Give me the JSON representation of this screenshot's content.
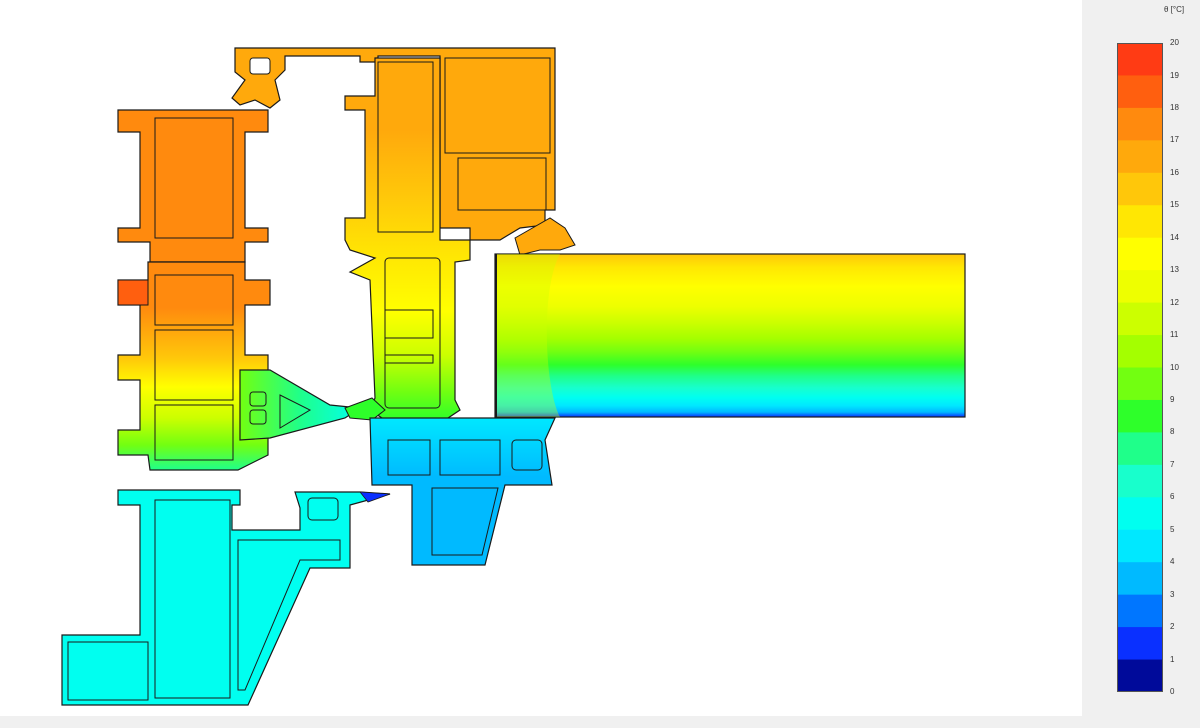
{
  "legend": {
    "unit_label": "θ [°C]",
    "ticks": [
      "20",
      "19",
      "18",
      "17",
      "16",
      "15",
      "14",
      "13",
      "12",
      "11",
      "10",
      "9",
      "8",
      "7",
      "6",
      "5",
      "4",
      "3",
      "2",
      "1",
      "0"
    ],
    "bands": [
      {
        "range": "19-20",
        "color": "#ff3b14"
      },
      {
        "range": "18-19",
        "color": "#ff5f0f"
      },
      {
        "range": "17-18",
        "color": "#ff8a0e"
      },
      {
        "range": "16-17",
        "color": "#ffa90c"
      },
      {
        "range": "15-16",
        "color": "#ffc70a"
      },
      {
        "range": "14-15",
        "color": "#ffe703"
      },
      {
        "range": "13-14",
        "color": "#ffff00"
      },
      {
        "range": "12-13",
        "color": "#eeff00"
      },
      {
        "range": "11-12",
        "color": "#ccff00"
      },
      {
        "range": "10-11",
        "color": "#a4ff00"
      },
      {
        "range": "9-10",
        "color": "#72ff11"
      },
      {
        "range": "8-9",
        "color": "#2eff2a"
      },
      {
        "range": "7-8",
        "color": "#1fff8a"
      },
      {
        "range": "6-7",
        "color": "#18ffcc"
      },
      {
        "range": "5-6",
        "color": "#00fff0"
      },
      {
        "range": "4-5",
        "color": "#00e8ff"
      },
      {
        "range": "3-4",
        "color": "#00baff"
      },
      {
        "range": "2-3",
        "color": "#0076ff"
      },
      {
        "range": "1-2",
        "color": "#0a30ff"
      },
      {
        "range": "0-1",
        "color": "#000a9a"
      }
    ]
  },
  "diagram": {
    "colors": {
      "outline": "#1a1a1a",
      "cavity": "#ffffff",
      "sash_top": "#ff8a0e",
      "sash_mid": "#ffe703",
      "sash_bottom": "#2eff2a",
      "frame_top": "#ffa90c",
      "frame_mid": "#ffff00",
      "frame_bottom": "#00e8ff",
      "sill": "#00fff0",
      "lower_frame": "#00baff",
      "wing": "#1fff8a",
      "cold_tip": "#0a30ff"
    }
  }
}
